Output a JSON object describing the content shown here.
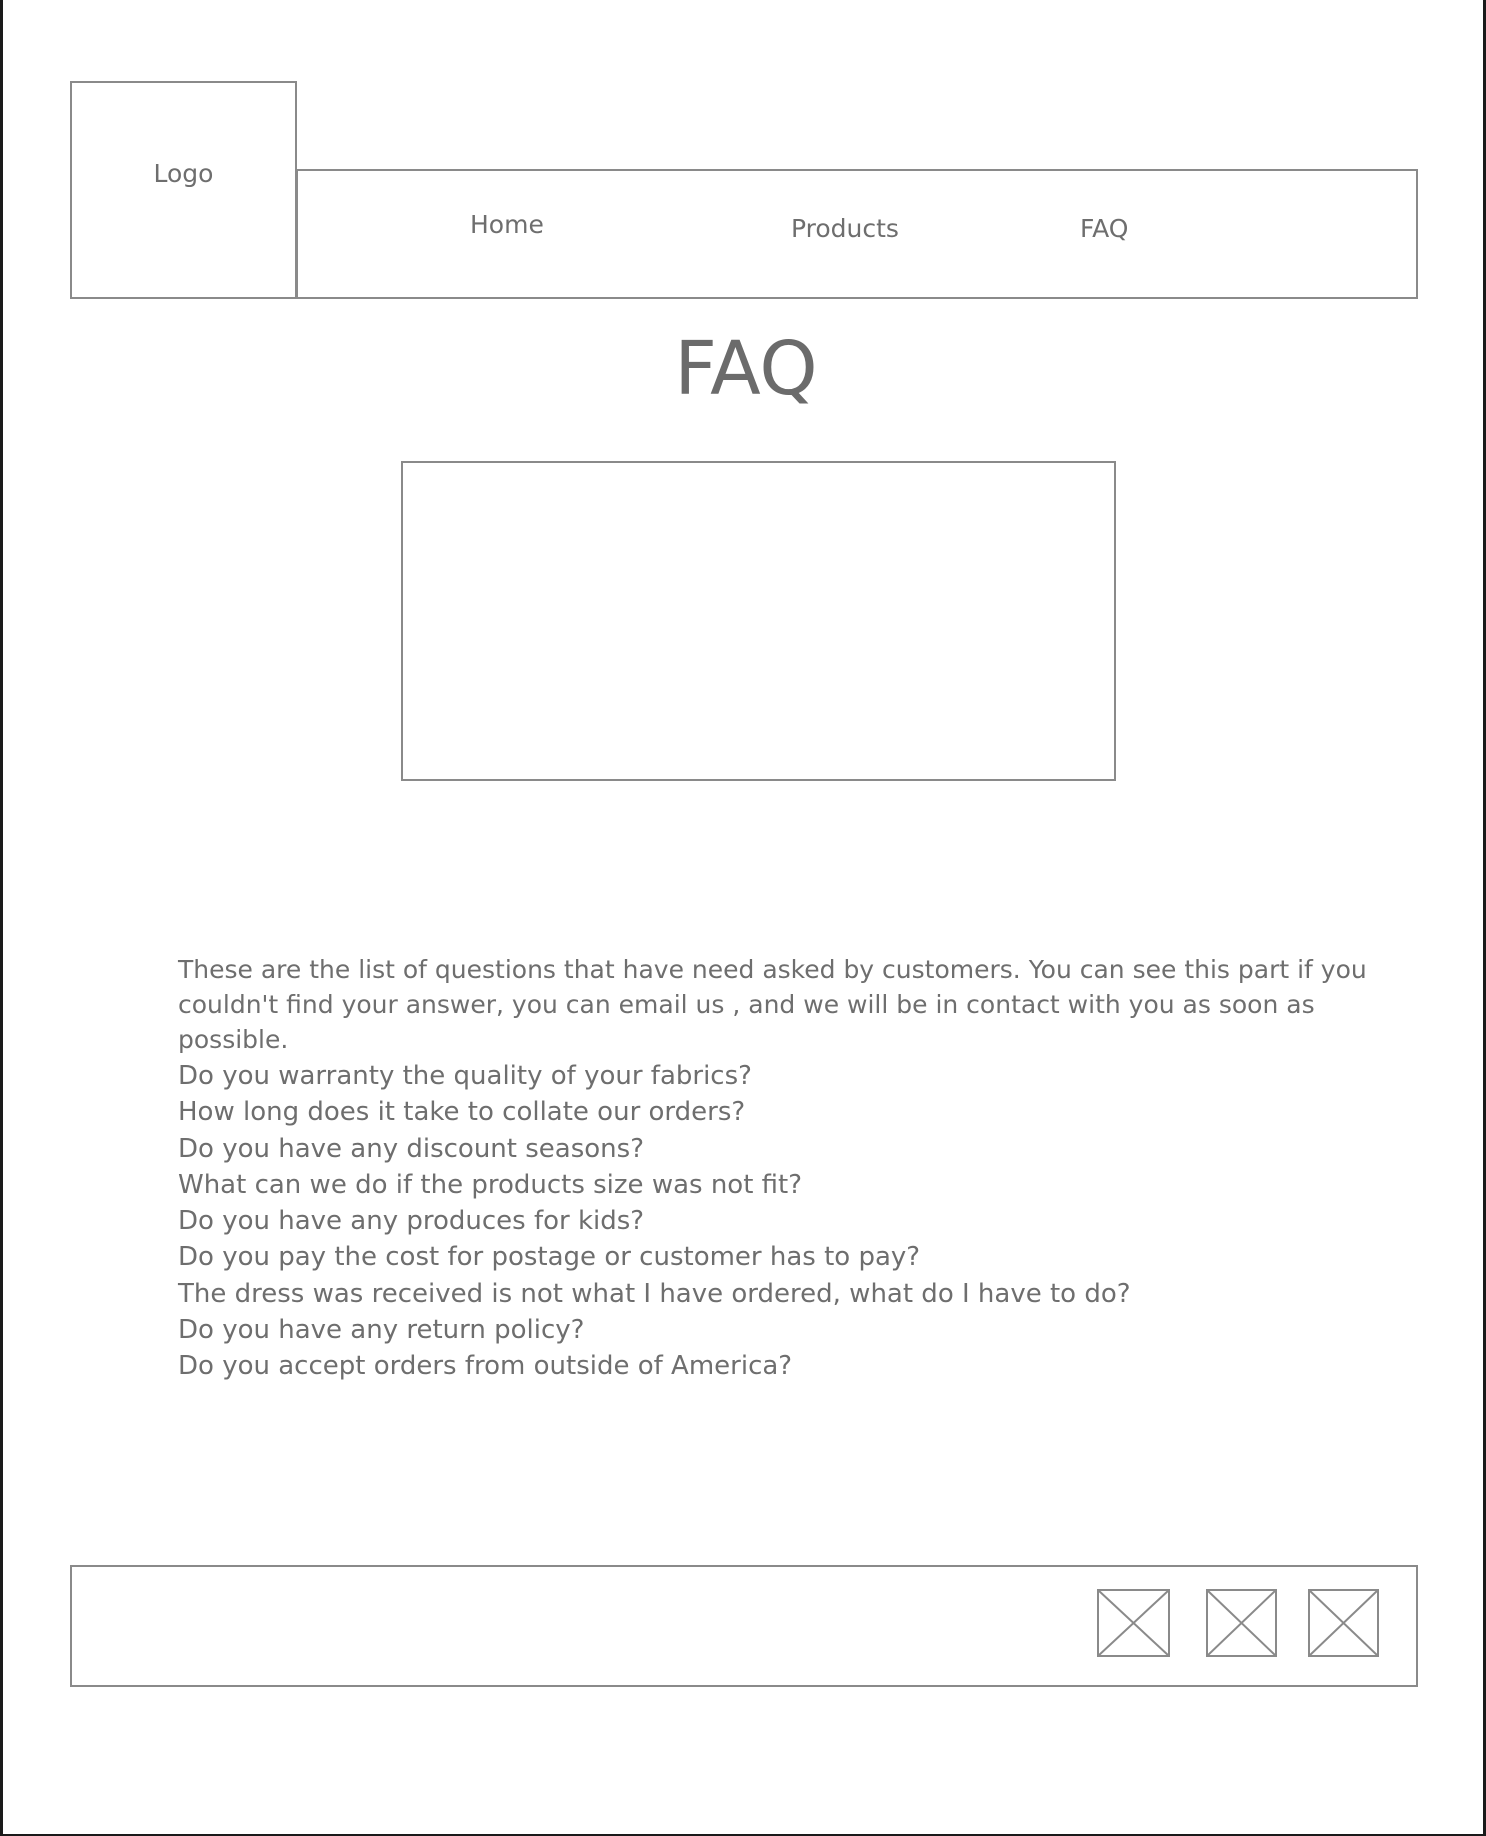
{
  "header": {
    "logo_label": "Logo",
    "nav": {
      "home": "Home",
      "products": "Products",
      "faq": "FAQ"
    }
  },
  "main": {
    "title": "FAQ",
    "intro": "These are the list of questions that have need asked by customers. You can see this part if you couldn't find your answer, you can email us , and we will be in contact with you as soon as possible.",
    "questions": [
      "Do you warranty the quality of your fabrics?",
      "How long does it take to collate our orders?",
      "Do you have any discount seasons?",
      "What can we do if the products size was not fit?",
      "Do you have any produces for kids?",
      "Do you pay the cost for postage or customer has to pay?",
      "The dress was received is not what I have ordered, what do I have to do?",
      "Do you have any return policy?",
      "Do you accept orders from outside of America?"
    ]
  },
  "footer": {
    "icons": [
      "image-placeholder-icon",
      "image-placeholder-icon",
      "image-placeholder-icon"
    ]
  },
  "colors": {
    "border": "#8a8a8a",
    "text": "#6e6e6e",
    "frame": "#1a1a1a"
  }
}
